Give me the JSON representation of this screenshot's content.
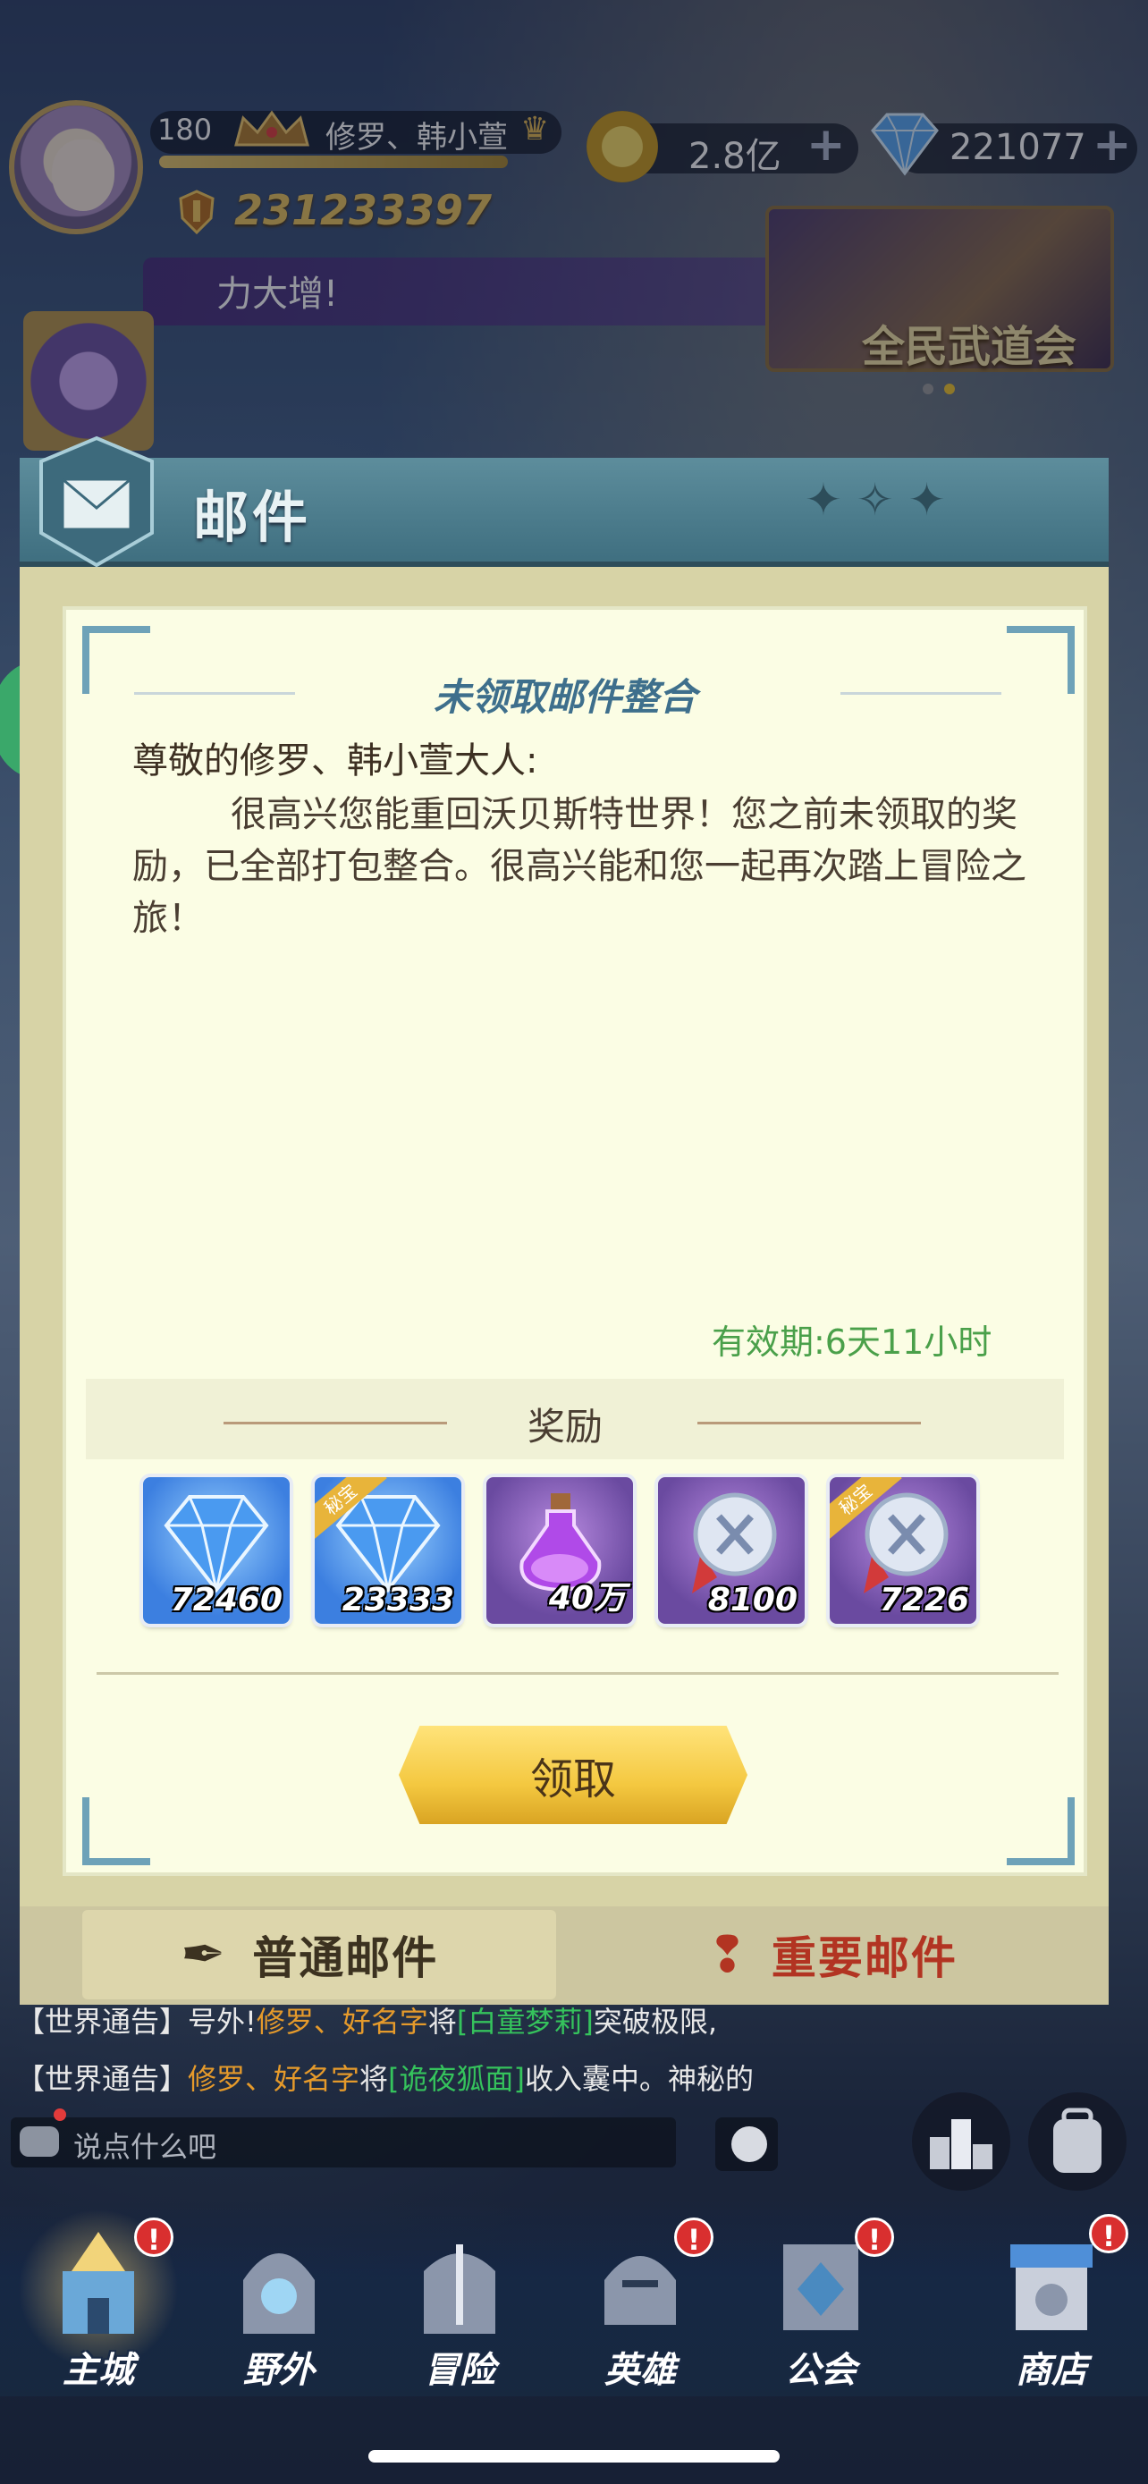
{
  "hud": {
    "level": "180",
    "player_name": "修罗、韩小萱",
    "power": "231233397",
    "gold": "2.8亿",
    "gems": "221077",
    "plus": "+",
    "marquee": "力大增!",
    "event_banner": "全民武道会"
  },
  "mail": {
    "window_title": "邮件",
    "subject": "未领取邮件整合",
    "greeting": "尊敬的修罗、韩小萱大人:",
    "body": "很高兴您能重回沃贝斯特世界！您之前未领取的奖励，已全部打包整合。很高兴能和您一起再次踏上冒险之旅！",
    "expire": "有效期:6天11小时",
    "reward_title": "奖励",
    "rewards": [
      {
        "icon": "diamond-icon",
        "qty": "72460",
        "tag": ""
      },
      {
        "icon": "diamond-icon",
        "qty": "23333",
        "tag": "秘宝"
      },
      {
        "icon": "potion-icon",
        "qty": "40万",
        "tag": ""
      },
      {
        "icon": "medal-icon",
        "qty": "8100",
        "tag": ""
      },
      {
        "icon": "medal-icon",
        "qty": "7226",
        "tag": "秘宝"
      }
    ],
    "claim_label": "领取",
    "tabs": {
      "normal": "普通邮件",
      "important": "重要邮件"
    }
  },
  "chat": {
    "line1": {
      "channel": "【世界通告】",
      "pre": "号外!",
      "player": "修罗、好名字",
      "mid": "将",
      "item": "[白童梦莉]",
      "post": "突破极限,"
    },
    "line2": {
      "channel": "【世界通告】",
      "player": "修罗、好名字",
      "mid": "将",
      "item": "[诡夜狐面]",
      "post": "收入囊中。神秘的"
    },
    "placeholder": "说点什么吧"
  },
  "nav": {
    "items": [
      "主城",
      "野外",
      "冒险",
      "英雄",
      "公会",
      "商店"
    ],
    "alert": "!"
  },
  "colors": {
    "accent_gold": "#f4c840",
    "mail_header": "#4f7f90",
    "expire_green": "#4aa04a",
    "important_red": "#b23422"
  }
}
